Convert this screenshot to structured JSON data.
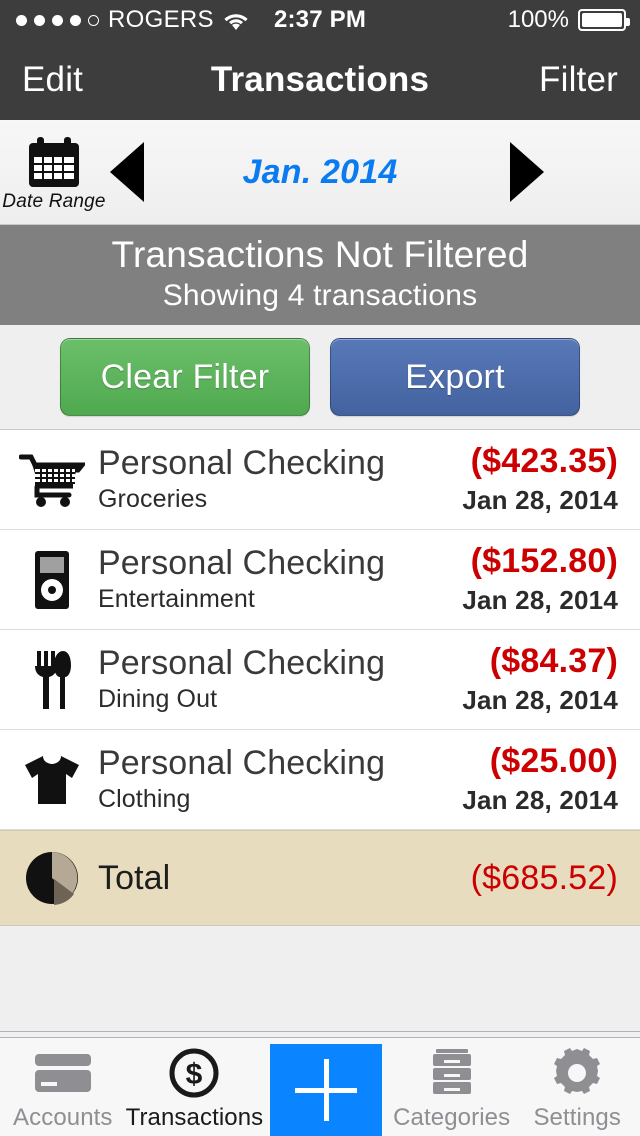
{
  "status_bar": {
    "signal_dots_filled": 4,
    "signal_dots_total": 5,
    "carrier": "ROGERS",
    "wifi_icon": "wifi-icon",
    "time": "2:37 PM",
    "battery_percent": "100%",
    "battery_icon": "battery-full-icon"
  },
  "navbar": {
    "left_button": "Edit",
    "title": "Transactions",
    "right_button": "Filter"
  },
  "date_range_bar": {
    "calendar_icon": "calendar-icon",
    "calendar_label": "Date Range",
    "prev_icon": "triangle-left-icon",
    "next_icon": "triangle-right-icon",
    "period": "Jan. 2014",
    "period_color": "#0b7bf1"
  },
  "filter_banner": {
    "title": "Transactions Not Filtered",
    "subtitle": "Showing 4 transactions",
    "background": "#808080"
  },
  "actions": {
    "clear_filter_label": "Clear Filter",
    "clear_filter_color": "#5cb85c",
    "export_label": "Export",
    "export_color": "#4b6cb0"
  },
  "transactions": [
    {
      "icon": "shopping-cart-icon",
      "account": "Personal Checking",
      "category": "Groceries",
      "amount": "($423.35)",
      "date": "Jan 28, 2014"
    },
    {
      "icon": "music-player-icon",
      "account": "Personal Checking",
      "category": "Entertainment",
      "amount": "($152.80)",
      "date": "Jan 28, 2014"
    },
    {
      "icon": "fork-knife-icon",
      "account": "Personal Checking",
      "category": "Dining Out",
      "amount": "($84.37)",
      "date": "Jan 28, 2014"
    },
    {
      "icon": "tshirt-icon",
      "account": "Personal Checking",
      "category": "Clothing",
      "amount": "($25.00)",
      "date": "Jan 28, 2014"
    }
  ],
  "total_row": {
    "icon": "pie-chart-icon",
    "label": "Total",
    "amount": "($685.52)",
    "background": "#e8dcbe",
    "amount_color": "#cc0000"
  },
  "tab_bar": {
    "tabs": [
      {
        "icon": "credit-card-icon",
        "label": "Accounts",
        "active": false
      },
      {
        "icon": "dollar-circle-icon",
        "label": "Transactions",
        "active": true
      },
      {
        "icon": "plus-icon",
        "label": "",
        "active": false
      },
      {
        "icon": "file-cabinet-icon",
        "label": "Categories",
        "active": false
      },
      {
        "icon": "gear-icon",
        "label": "Settings",
        "active": false
      }
    ],
    "add_button_color": "#0a84ff"
  }
}
